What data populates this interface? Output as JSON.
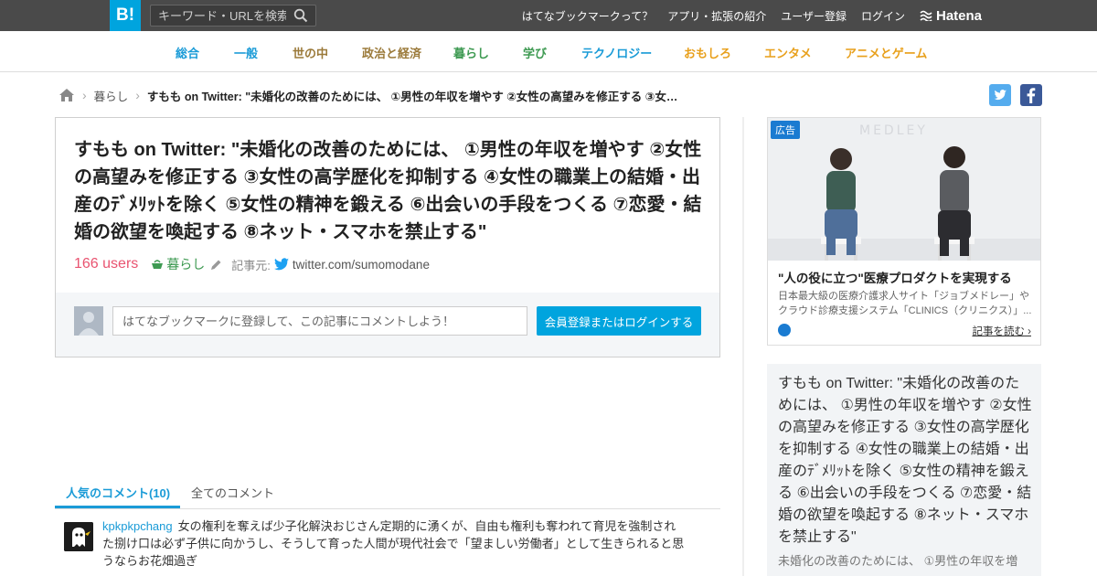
{
  "header": {
    "logo_text": "B!",
    "search_placeholder": "キーワード・URLを検索",
    "nav": [
      "はてなブックマークって？",
      "アプリ・拡張の紹介",
      "ユーザー登録",
      "ログイン"
    ],
    "hatena_label": "Hatena",
    "brand_color": "#00a4de"
  },
  "categories": [
    {
      "label": "総合",
      "color": "#1a9bd7"
    },
    {
      "label": "一般",
      "color": "#1a9bd7"
    },
    {
      "label": "世の中",
      "color": "#9b7a3a"
    },
    {
      "label": "政治と経済",
      "color": "#9b7a3a"
    },
    {
      "label": "暮らし",
      "color": "#3e9a52"
    },
    {
      "label": "学び",
      "color": "#3e9a52"
    },
    {
      "label": "テクノロジー",
      "color": "#1a9bd7"
    },
    {
      "label": "おもしろ",
      "color": "#e8a01c"
    },
    {
      "label": "エンタメ",
      "color": "#e8a01c"
    },
    {
      "label": "アニメとゲーム",
      "color": "#e8a01c"
    }
  ],
  "breadcrumb": {
    "category": "暮らし",
    "current": "すもも on Twitter: \"未婚化の改善のためには、 ①男性の年収を増やす ②女性の高望みを修正する ③女性の..."
  },
  "entry": {
    "title": "すもも on Twitter: \"未婚化の改善のためには、 ①男性の年収を増やす ②女性の高望みを修正する ③女性の高学歴化を抑制する ④女性の職業上の結婚・出産のﾃﾞﾒﾘｯﾄを除く ⑤女性の精神を鍛える ⑥出会いの手段をつくる ⑦恋愛・結婚の欲望を喚起する ⑧ネット・スマホを禁止する\"",
    "users": "166 users",
    "category": "暮らし",
    "source_label": "記事元:",
    "source": "twitter.com/sumomodane",
    "comment_placeholder": "はてなブックマークに登録して、この記事にコメントしよう！",
    "login_button": "会員登録またはログインする"
  },
  "tabs": {
    "popular": "人気のコメント(10)",
    "all": "全てのコメント"
  },
  "comments": [
    {
      "user": "kpkpkpchang",
      "text": "女の権利を奪えば少子化解決おじさん定期的に湧くが、自由も権利も奪われて育児を強制された捌け口は必ず子供に向かうし、そうして育った人間が現代社会で「望ましい労働者」として生きられると思うならお花畑過ぎ"
    }
  ],
  "ad": {
    "badge": "広告",
    "title": "\"人の役に立つ\"医療プロダクトを実現する",
    "description": "日本最大級の医療介護求人サイト「ジョブメドレー」やクラウド診療支援システム「CLINICS（クリニクス）」...",
    "read_more": "記事を読む"
  },
  "summary": {
    "title": "すもも on Twitter: \"未婚化の改善のためには、 ①男性の年収を増やす ②女性の高望みを修正する ③女性の高学歴化を抑制する ④女性の職業上の結婚・出産のﾃﾞﾒﾘｯﾄを除く ⑤女性の精神を鍛える ⑥出会いの手段をつくる ⑦恋愛・結婚の欲望を喚起する ⑧ネット・スマホを禁止する\"",
    "description": "未婚化の改善のためには、 ①男性の年収を増"
  }
}
